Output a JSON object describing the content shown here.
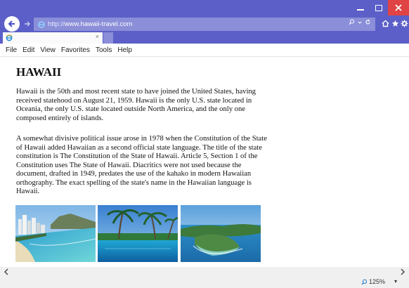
{
  "browser": {
    "url_prefix": "http://",
    "url_host": "www.hawaii-travel.com",
    "address_icons": "ρ ▾ Ƈ",
    "tab_close": "×"
  },
  "menu": [
    "File",
    "Edit",
    "View",
    "Favorites",
    "Tools",
    "Help"
  ],
  "page": {
    "title": "HAWAII",
    "paragraphs": [
      "Hawaii is the 50th and most recent state to have joined the United States, having received statehood on August 21, 1959. Hawaii is the only U.S. state located in Oceania, the only U.S. state located outside North America, and the only one composed entirely of islands.",
      "A somewhat divisive political issue arose in 1978 when the Constitution of the State of Hawaii added Hawaiian as a second official state language. The title of the state constitution is The Constitution of the State of Hawaii. Article 5, Section 1 of the Constitution uses The State of Hawaii. Diacritics were not used because the document, drafted in 1949, predates the use of the kahako in modern Hawaiian orthography. The exact spelling of the state's name in the Hawaiian language is Hawaii."
    ]
  },
  "status": {
    "zoom": "125%",
    "zoom_dropdown": "▾"
  },
  "colors": {
    "chrome": "#5b5fc7",
    "address_bar": "#8b8ed8",
    "close_button": "#e04343"
  },
  "icons": [
    "back-arrow-icon",
    "forward-arrow-icon",
    "ie-logo-icon",
    "search-icon",
    "refresh-icon",
    "home-icon",
    "favorites-star-icon",
    "gear-icon",
    "zoom-icon"
  ]
}
